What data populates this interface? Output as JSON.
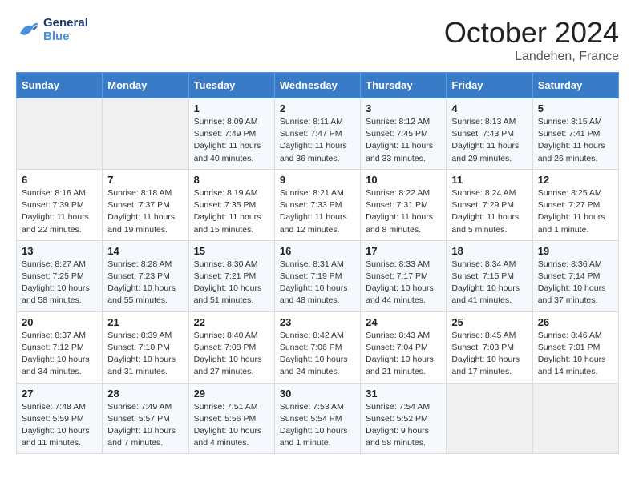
{
  "logo": {
    "text_general": "General",
    "text_blue": "Blue"
  },
  "title": {
    "month": "October 2024",
    "location": "Landehen, France"
  },
  "headers": [
    "Sunday",
    "Monday",
    "Tuesday",
    "Wednesday",
    "Thursday",
    "Friday",
    "Saturday"
  ],
  "weeks": [
    [
      {
        "day": "",
        "empty": true
      },
      {
        "day": "",
        "empty": true
      },
      {
        "day": "1",
        "sunrise": "Sunrise: 8:09 AM",
        "sunset": "Sunset: 7:49 PM",
        "daylight": "Daylight: 11 hours and 40 minutes."
      },
      {
        "day": "2",
        "sunrise": "Sunrise: 8:11 AM",
        "sunset": "Sunset: 7:47 PM",
        "daylight": "Daylight: 11 hours and 36 minutes."
      },
      {
        "day": "3",
        "sunrise": "Sunrise: 8:12 AM",
        "sunset": "Sunset: 7:45 PM",
        "daylight": "Daylight: 11 hours and 33 minutes."
      },
      {
        "day": "4",
        "sunrise": "Sunrise: 8:13 AM",
        "sunset": "Sunset: 7:43 PM",
        "daylight": "Daylight: 11 hours and 29 minutes."
      },
      {
        "day": "5",
        "sunrise": "Sunrise: 8:15 AM",
        "sunset": "Sunset: 7:41 PM",
        "daylight": "Daylight: 11 hours and 26 minutes."
      }
    ],
    [
      {
        "day": "6",
        "sunrise": "Sunrise: 8:16 AM",
        "sunset": "Sunset: 7:39 PM",
        "daylight": "Daylight: 11 hours and 22 minutes."
      },
      {
        "day": "7",
        "sunrise": "Sunrise: 8:18 AM",
        "sunset": "Sunset: 7:37 PM",
        "daylight": "Daylight: 11 hours and 19 minutes."
      },
      {
        "day": "8",
        "sunrise": "Sunrise: 8:19 AM",
        "sunset": "Sunset: 7:35 PM",
        "daylight": "Daylight: 11 hours and 15 minutes."
      },
      {
        "day": "9",
        "sunrise": "Sunrise: 8:21 AM",
        "sunset": "Sunset: 7:33 PM",
        "daylight": "Daylight: 11 hours and 12 minutes."
      },
      {
        "day": "10",
        "sunrise": "Sunrise: 8:22 AM",
        "sunset": "Sunset: 7:31 PM",
        "daylight": "Daylight: 11 hours and 8 minutes."
      },
      {
        "day": "11",
        "sunrise": "Sunrise: 8:24 AM",
        "sunset": "Sunset: 7:29 PM",
        "daylight": "Daylight: 11 hours and 5 minutes."
      },
      {
        "day": "12",
        "sunrise": "Sunrise: 8:25 AM",
        "sunset": "Sunset: 7:27 PM",
        "daylight": "Daylight: 11 hours and 1 minute."
      }
    ],
    [
      {
        "day": "13",
        "sunrise": "Sunrise: 8:27 AM",
        "sunset": "Sunset: 7:25 PM",
        "daylight": "Daylight: 10 hours and 58 minutes."
      },
      {
        "day": "14",
        "sunrise": "Sunrise: 8:28 AM",
        "sunset": "Sunset: 7:23 PM",
        "daylight": "Daylight: 10 hours and 55 minutes."
      },
      {
        "day": "15",
        "sunrise": "Sunrise: 8:30 AM",
        "sunset": "Sunset: 7:21 PM",
        "daylight": "Daylight: 10 hours and 51 minutes."
      },
      {
        "day": "16",
        "sunrise": "Sunrise: 8:31 AM",
        "sunset": "Sunset: 7:19 PM",
        "daylight": "Daylight: 10 hours and 48 minutes."
      },
      {
        "day": "17",
        "sunrise": "Sunrise: 8:33 AM",
        "sunset": "Sunset: 7:17 PM",
        "daylight": "Daylight: 10 hours and 44 minutes."
      },
      {
        "day": "18",
        "sunrise": "Sunrise: 8:34 AM",
        "sunset": "Sunset: 7:15 PM",
        "daylight": "Daylight: 10 hours and 41 minutes."
      },
      {
        "day": "19",
        "sunrise": "Sunrise: 8:36 AM",
        "sunset": "Sunset: 7:14 PM",
        "daylight": "Daylight: 10 hours and 37 minutes."
      }
    ],
    [
      {
        "day": "20",
        "sunrise": "Sunrise: 8:37 AM",
        "sunset": "Sunset: 7:12 PM",
        "daylight": "Daylight: 10 hours and 34 minutes."
      },
      {
        "day": "21",
        "sunrise": "Sunrise: 8:39 AM",
        "sunset": "Sunset: 7:10 PM",
        "daylight": "Daylight: 10 hours and 31 minutes."
      },
      {
        "day": "22",
        "sunrise": "Sunrise: 8:40 AM",
        "sunset": "Sunset: 7:08 PM",
        "daylight": "Daylight: 10 hours and 27 minutes."
      },
      {
        "day": "23",
        "sunrise": "Sunrise: 8:42 AM",
        "sunset": "Sunset: 7:06 PM",
        "daylight": "Daylight: 10 hours and 24 minutes."
      },
      {
        "day": "24",
        "sunrise": "Sunrise: 8:43 AM",
        "sunset": "Sunset: 7:04 PM",
        "daylight": "Daylight: 10 hours and 21 minutes."
      },
      {
        "day": "25",
        "sunrise": "Sunrise: 8:45 AM",
        "sunset": "Sunset: 7:03 PM",
        "daylight": "Daylight: 10 hours and 17 minutes."
      },
      {
        "day": "26",
        "sunrise": "Sunrise: 8:46 AM",
        "sunset": "Sunset: 7:01 PM",
        "daylight": "Daylight: 10 hours and 14 minutes."
      }
    ],
    [
      {
        "day": "27",
        "sunrise": "Sunrise: 7:48 AM",
        "sunset": "Sunset: 5:59 PM",
        "daylight": "Daylight: 10 hours and 11 minutes."
      },
      {
        "day": "28",
        "sunrise": "Sunrise: 7:49 AM",
        "sunset": "Sunset: 5:57 PM",
        "daylight": "Daylight: 10 hours and 7 minutes."
      },
      {
        "day": "29",
        "sunrise": "Sunrise: 7:51 AM",
        "sunset": "Sunset: 5:56 PM",
        "daylight": "Daylight: 10 hours and 4 minutes."
      },
      {
        "day": "30",
        "sunrise": "Sunrise: 7:53 AM",
        "sunset": "Sunset: 5:54 PM",
        "daylight": "Daylight: 10 hours and 1 minute."
      },
      {
        "day": "31",
        "sunrise": "Sunrise: 7:54 AM",
        "sunset": "Sunset: 5:52 PM",
        "daylight": "Daylight: 9 hours and 58 minutes."
      },
      {
        "day": "",
        "empty": true
      },
      {
        "day": "",
        "empty": true
      }
    ]
  ]
}
